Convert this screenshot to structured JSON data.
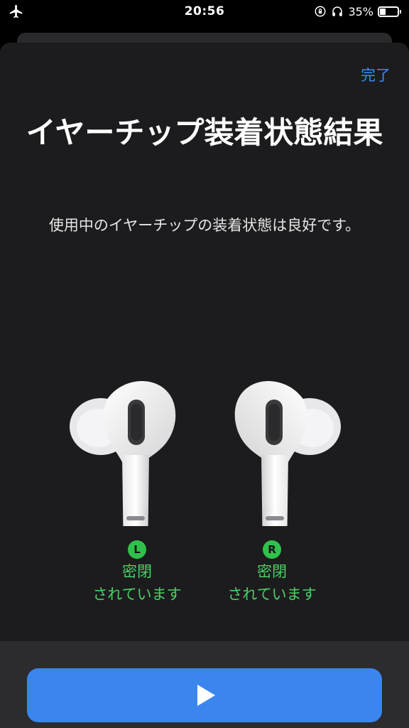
{
  "status_bar": {
    "time": "20:56",
    "battery_percent_label": "35%",
    "battery_level": 0.35,
    "icons": [
      "airplane-icon",
      "orientation-lock-icon",
      "headphones-icon",
      "battery-icon"
    ]
  },
  "header": {
    "done_label": "完了"
  },
  "title": "イヤーチップ装着状態結果",
  "subtitle": "使用中のイヤーチップの装着状態は良好です。",
  "earbuds": {
    "left": {
      "badge": "L",
      "status_line1": "密閉",
      "status_line2": "されています"
    },
    "right": {
      "badge": "R",
      "status_line1": "密閉",
      "status_line2": "されています"
    }
  },
  "footer": {
    "play_icon": "play-icon"
  },
  "colors": {
    "accent": "#3a8dff",
    "button": "#3a86ee",
    "success": "#4cd064",
    "badge": "#30c04b",
    "sheet_bg": "#1c1c1e"
  }
}
